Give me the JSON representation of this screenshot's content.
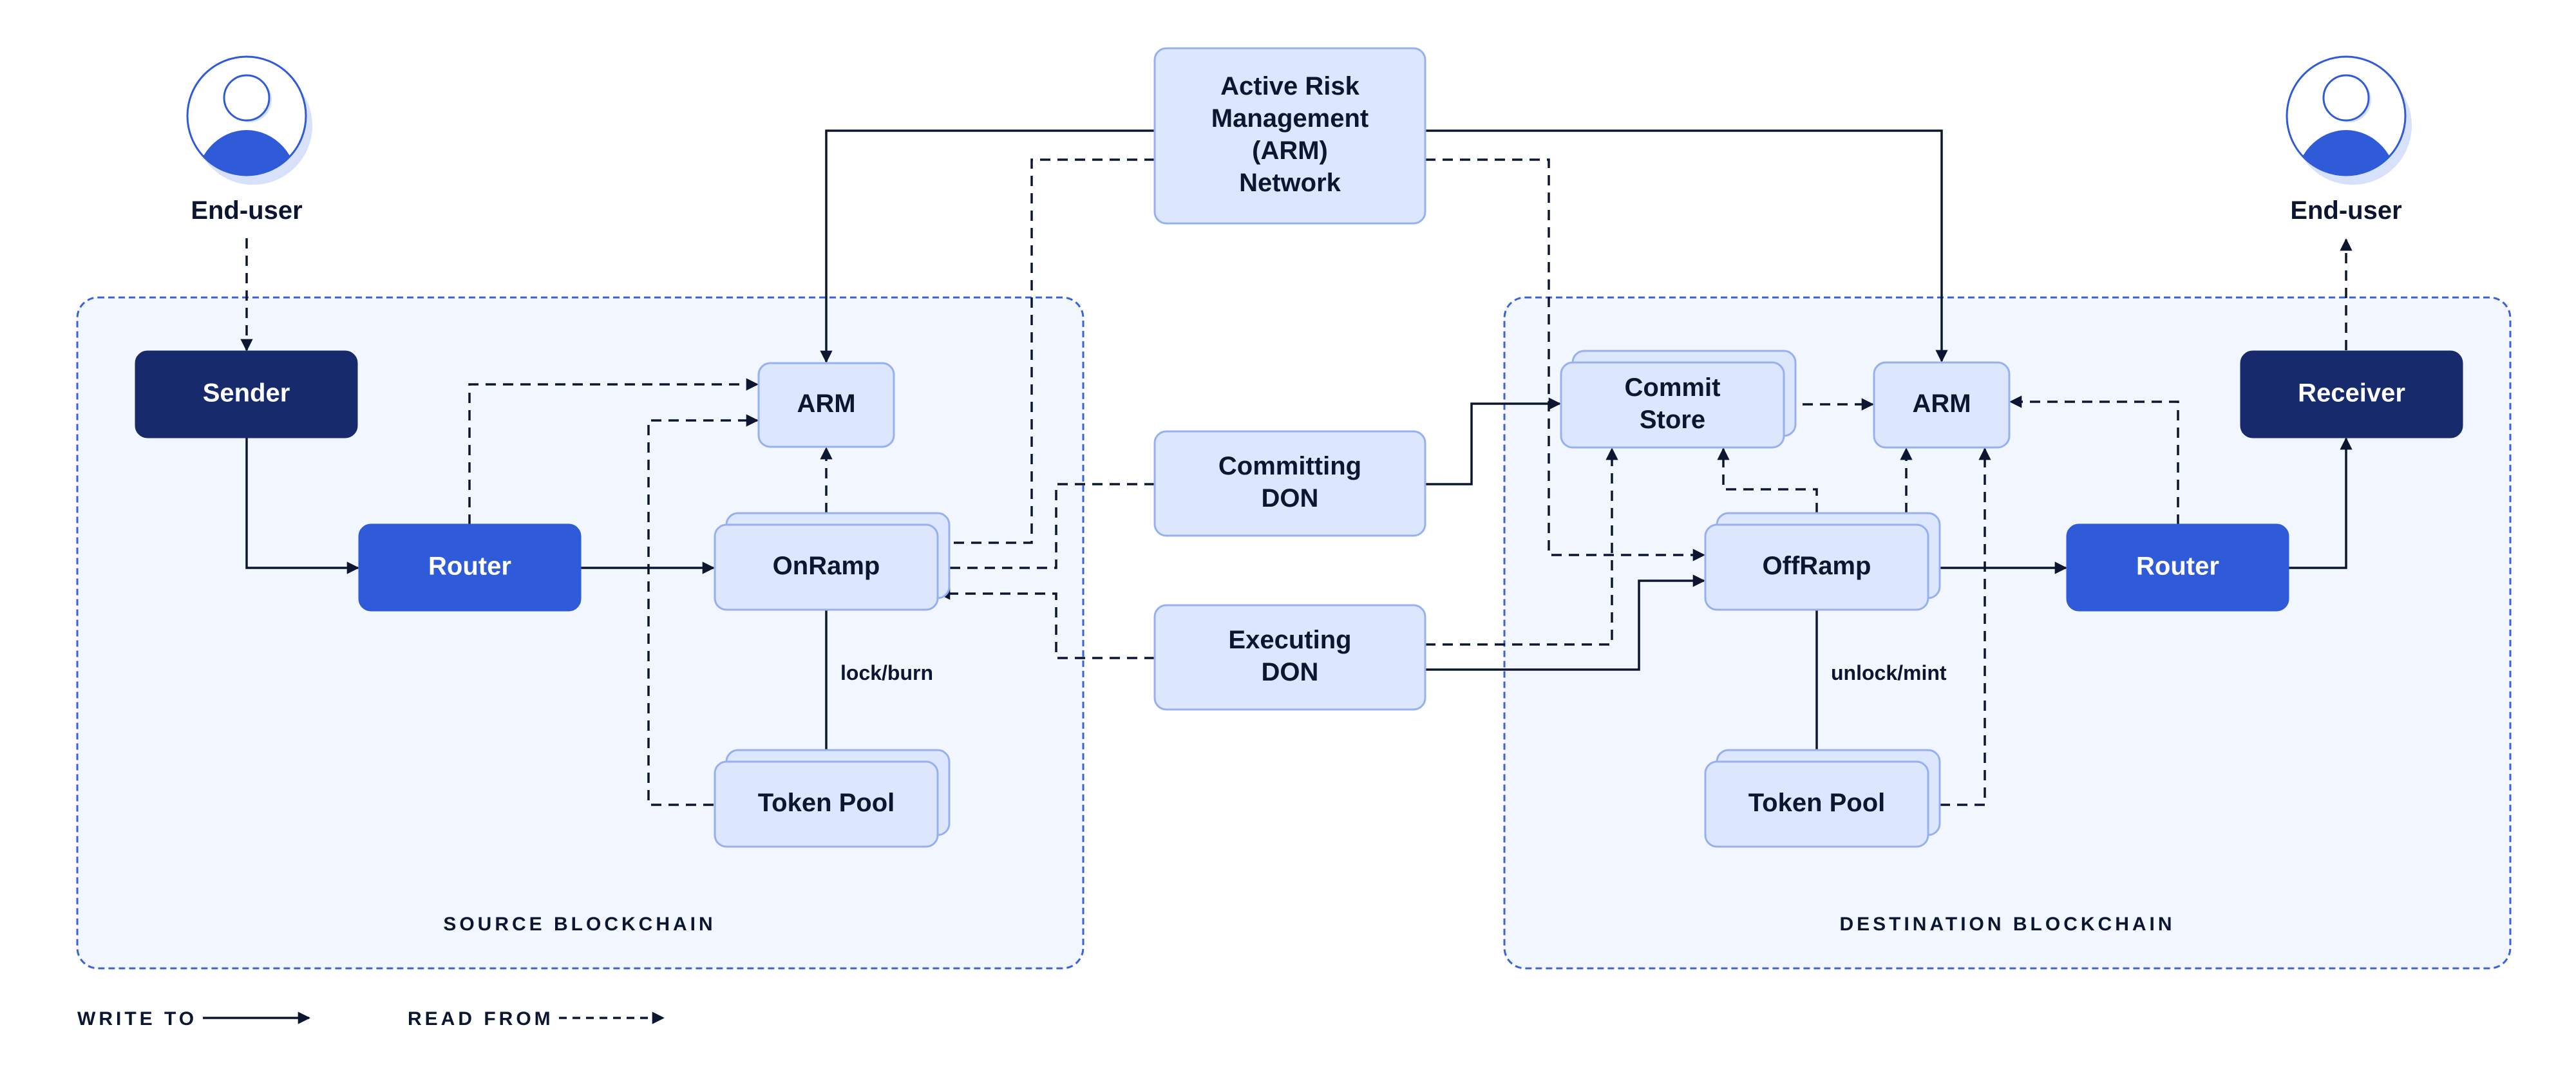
{
  "colors": {
    "ink": "#0c1631",
    "navy": "#172a6b",
    "blue": "#2f5ad8",
    "node_fill": "#dce6fc",
    "node_stroke": "#97b0f0",
    "region_fill": "#f2f6fe",
    "region_stroke": "#3a63d8",
    "avatar_shadow": "#d7e1fa"
  },
  "end_users": [
    {
      "id": "enduser-source",
      "label": "End-user"
    },
    {
      "id": "enduser-dest",
      "label": "End-user"
    }
  ],
  "regions": [
    {
      "id": "source-blockchain",
      "label": "SOURCE BLOCKCHAIN"
    },
    {
      "id": "destination-blockchain",
      "label": "DESTINATION BLOCKCHAIN"
    }
  ],
  "nodes": [
    {
      "id": "arm-network",
      "lines": [
        "Active Risk",
        "Management",
        "(ARM)",
        "Network"
      ],
      "style": "light"
    },
    {
      "id": "src-sender",
      "lines": [
        "Sender"
      ],
      "style": "navy"
    },
    {
      "id": "src-router",
      "lines": [
        "Router"
      ],
      "style": "blue"
    },
    {
      "id": "src-arm",
      "lines": [
        "ARM"
      ],
      "style": "light"
    },
    {
      "id": "src-onramp",
      "lines": [
        "OnRamp"
      ],
      "style": "light-stacked"
    },
    {
      "id": "src-token-pool",
      "lines": [
        "Token Pool"
      ],
      "style": "light-stacked"
    },
    {
      "id": "committing-don",
      "lines": [
        "Committing",
        "DON"
      ],
      "style": "light"
    },
    {
      "id": "executing-don",
      "lines": [
        "Executing",
        "DON"
      ],
      "style": "light"
    },
    {
      "id": "dst-commit-store",
      "lines": [
        "Commit",
        "Store"
      ],
      "style": "light-stacked"
    },
    {
      "id": "dst-arm",
      "lines": [
        "ARM"
      ],
      "style": "light"
    },
    {
      "id": "dst-offramp",
      "lines": [
        "OffRamp"
      ],
      "style": "light-stacked"
    },
    {
      "id": "dst-token-pool",
      "lines": [
        "Token Pool"
      ],
      "style": "light-stacked"
    },
    {
      "id": "dst-router",
      "lines": [
        "Router"
      ],
      "style": "blue"
    },
    {
      "id": "dst-receiver",
      "lines": [
        "Receiver"
      ],
      "style": "navy"
    }
  ],
  "edge_labels": [
    {
      "id": "lock-burn",
      "text": "lock/burn"
    },
    {
      "id": "unlock-mint",
      "text": "unlock/mint"
    }
  ],
  "edges": [
    {
      "from": "enduser-source",
      "to": "src-sender",
      "kind": "read"
    },
    {
      "from": "src-sender",
      "to": "src-router",
      "kind": "write"
    },
    {
      "from": "src-router",
      "to": "src-onramp",
      "kind": "write"
    },
    {
      "from": "src-router",
      "to": "src-arm",
      "kind": "read"
    },
    {
      "from": "src-token-pool",
      "to": "src-arm",
      "kind": "read"
    },
    {
      "from": "src-onramp",
      "to": "src-arm",
      "kind": "read"
    },
    {
      "from": "src-onramp",
      "to": "src-token-pool",
      "kind": "write",
      "label": "lock/burn"
    },
    {
      "from": "arm-network",
      "to": "src-arm",
      "kind": "write"
    },
    {
      "from": "arm-network",
      "to": "dst-arm",
      "kind": "write"
    },
    {
      "from": "arm-network",
      "to": "src-onramp",
      "kind": "read"
    },
    {
      "from": "arm-network",
      "to": "dst-offramp",
      "kind": "read"
    },
    {
      "from": "committing-don",
      "to": "src-onramp",
      "kind": "read"
    },
    {
      "from": "executing-don",
      "to": "src-onramp",
      "kind": "read"
    },
    {
      "from": "committing-don",
      "to": "dst-commit-store",
      "kind": "write"
    },
    {
      "from": "executing-don",
      "to": "dst-commit-store",
      "kind": "read"
    },
    {
      "from": "executing-don",
      "to": "dst-offramp",
      "kind": "write"
    },
    {
      "from": "dst-commit-store",
      "to": "dst-arm",
      "kind": "read"
    },
    {
      "from": "dst-offramp",
      "to": "dst-commit-store",
      "kind": "read"
    },
    {
      "from": "dst-offramp",
      "to": "dst-arm",
      "kind": "read"
    },
    {
      "from": "dst-token-pool",
      "to": "dst-arm",
      "kind": "read"
    },
    {
      "from": "dst-offramp",
      "to": "dst-token-pool",
      "kind": "write",
      "label": "unlock/mint"
    },
    {
      "from": "dst-offramp",
      "to": "dst-router",
      "kind": "write"
    },
    {
      "from": "dst-router",
      "to": "dst-arm",
      "kind": "read"
    },
    {
      "from": "dst-router",
      "to": "dst-receiver",
      "kind": "write"
    },
    {
      "from": "dst-receiver",
      "to": "enduser-dest",
      "kind": "read"
    }
  ],
  "legend": {
    "write_label": "WRITE TO",
    "read_label": "READ FROM"
  }
}
